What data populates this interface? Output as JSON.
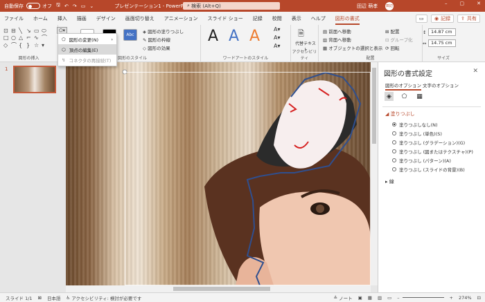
{
  "titlebar": {
    "autosave_label": "自動保存",
    "autosave_state": "オフ",
    "doc_title": "プレゼンテーション1 - PowerPoint",
    "search_placeholder": "検索 (Alt+Q)",
    "user_name": "田辺 萌孝",
    "user_initials": "田辺"
  },
  "tabs": [
    "ファイル",
    "ホーム",
    "挿入",
    "描画",
    "デザイン",
    "画面切り替え",
    "アニメーション",
    "スライド ショー",
    "記録",
    "校閲",
    "表示",
    "ヘルプ",
    "図形の書式"
  ],
  "active_tab": "図形の書式",
  "ribbon_right": {
    "record": "記録",
    "share": "共有"
  },
  "ribbon": {
    "insert_shapes": {
      "label": "図形の挿入"
    },
    "shape_styles": {
      "label": "図形のスタイル",
      "preset": "Abc",
      "fill": "図形の塗りつぶし",
      "outline": "図形の枠線",
      "effects": "図形の効果"
    },
    "wordart": {
      "label": "ワードアートのスタイル",
      "letter": "A"
    },
    "accessibility": {
      "label": "アクセシビリティ",
      "alt_text": "代替テキスト"
    },
    "arrange": {
      "label": "配置",
      "bring_forward": "前面へ移動",
      "send_backward": "背面へ移動",
      "selection_pane": "オブジェクトの選択と表示",
      "align": "配置",
      "group": "グループ化",
      "rotate": "回転"
    },
    "size": {
      "label": "サイズ",
      "height": "14.87 cm",
      "width": "14.75 cm"
    }
  },
  "dropdown": {
    "items": [
      {
        "label": "図形の変更(N)",
        "arrow": "›"
      },
      {
        "label": "頂点の編集(E)"
      },
      {
        "label": "コネクタの再接続(T)"
      }
    ],
    "selected_index": 1,
    "disabled_index": 2
  },
  "slides": {
    "number": "1"
  },
  "right_pane": {
    "title": "図形の書式設定",
    "tabs": [
      "図形のオプション",
      "文字のオプション"
    ],
    "fill_section": "塗りつぶし",
    "line_section": "線",
    "fill_options": [
      "塗りつぶしなし(N)",
      "塗りつぶし (単色)(S)",
      "塗りつぶし (グラデーション)(G)",
      "塗りつぶし (図またはテクスチャ)(P)",
      "塗りつぶし (パターン)(A)",
      "塗りつぶし (スライドの背景)(B)"
    ],
    "selected_fill": 0
  },
  "statusbar": {
    "slide": "スライド 1/1",
    "language": "日本語",
    "accessibility": "アクセシビリティ: 検討が必要です",
    "notes": "ノート",
    "zoom": "274%"
  },
  "colors": {
    "accent": "#b7472a",
    "outline": "#2f4f8f"
  }
}
